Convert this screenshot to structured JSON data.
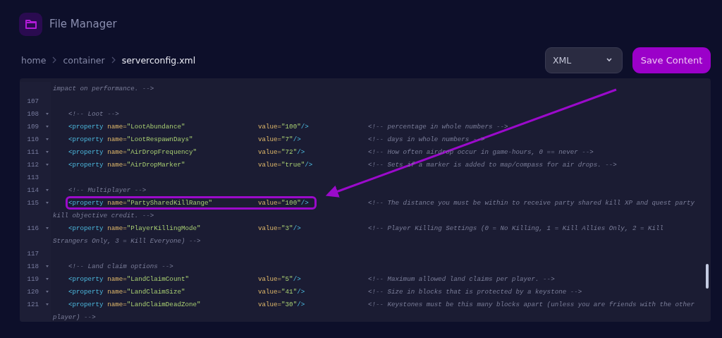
{
  "app": {
    "title": "File Manager"
  },
  "breadcrumb": [
    {
      "label": "home",
      "current": false
    },
    {
      "label": "container",
      "current": false
    },
    {
      "label": "serverconfig.xml",
      "current": true
    }
  ],
  "format_select": {
    "value": "XML"
  },
  "save_button": {
    "label": "Save Content"
  },
  "editor": {
    "lines": [
      {
        "kind": "wrap",
        "text": "impact on performance. -->"
      },
      {
        "kind": "blank",
        "number": "107"
      },
      {
        "kind": "comment",
        "number": "108",
        "text": "<!-- Loot -->"
      },
      {
        "kind": "property",
        "number": "109",
        "open": "<property",
        "attr1": "name=",
        "name": "\"LootAbundance\"",
        "attr2": "value=",
        "value": "\"100\"",
        "close": "/>",
        "comment": "<!-- percentage in whole numbers -->",
        "highlighted": false
      },
      {
        "kind": "property",
        "number": "110",
        "open": "<property",
        "attr1": "name=",
        "name": "\"LootRespawnDays\"",
        "attr2": "value=",
        "value": "\"7\"",
        "close": "/>",
        "comment": "<!-- days in whole numbers -->",
        "highlighted": false
      },
      {
        "kind": "property",
        "number": "111",
        "open": "<property",
        "attr1": "name=",
        "name": "\"AirDropFrequency\"",
        "attr2": "value=",
        "value": "\"72\"",
        "close": "/>",
        "comment": "<!-- How often airdrop occur in game-hours, 0 == never -->",
        "highlighted": false
      },
      {
        "kind": "property",
        "number": "112",
        "open": "<property",
        "attr1": "name=",
        "name": "\"AirDropMarker\"",
        "attr2": "value=",
        "value": "\"true\"",
        "close": "/>",
        "comment": "<!-- Sets if a marker is added to map/compass for air drops. -->",
        "highlighted": false
      },
      {
        "kind": "blank",
        "number": "113"
      },
      {
        "kind": "comment",
        "number": "114",
        "text": "<!-- Multiplayer -->"
      },
      {
        "kind": "property",
        "number": "115",
        "open": "<property",
        "attr1": "name=",
        "name": "\"PartySharedKillRange\"",
        "attr2": "value=",
        "value": "\"100\"",
        "close": "/>",
        "comment": "<!-- The distance you must be within to receive party shared kill XP and quest party",
        "highlighted": true
      },
      {
        "kind": "wrap",
        "text": "kill objective credit. -->"
      },
      {
        "kind": "property",
        "number": "116",
        "open": "<property",
        "attr1": "name=",
        "name": "\"PlayerKillingMode\"",
        "attr2": "value=",
        "value": "\"3\"",
        "close": "/>",
        "comment": "<!-- Player Killing Settings (0 = No Killing, 1 = Kill Allies Only, 2 = Kill",
        "highlighted": false
      },
      {
        "kind": "wrap",
        "text": "Strangers Only, 3 = Kill Everyone) -->"
      },
      {
        "kind": "blank",
        "number": "117"
      },
      {
        "kind": "comment",
        "number": "118",
        "text": "<!-- Land claim options -->"
      },
      {
        "kind": "property",
        "number": "119",
        "open": "<property",
        "attr1": "name=",
        "name": "\"LandClaimCount\"",
        "attr2": "value=",
        "value": "\"5\"",
        "close": "/>",
        "comment": "<!-- Maximum allowed land claims per player. -->",
        "highlighted": false
      },
      {
        "kind": "property",
        "number": "120",
        "open": "<property",
        "attr1": "name=",
        "name": "\"LandClaimSize\"",
        "attr2": "value=",
        "value": "\"41\"",
        "close": "/>",
        "comment": "<!-- Size in blocks that is protected by a keystone -->",
        "highlighted": false
      },
      {
        "kind": "property",
        "number": "121",
        "open": "<property",
        "attr1": "name=",
        "name": "\"LandClaimDeadZone\"",
        "attr2": "value=",
        "value": "\"30\"",
        "close": "/>",
        "comment": "<!-- Keystones must be this many blocks apart (unless you are friends with the other",
        "highlighted": false
      },
      {
        "kind": "wrap",
        "text": "player) -->"
      }
    ]
  },
  "callout": {
    "arrow": true
  }
}
